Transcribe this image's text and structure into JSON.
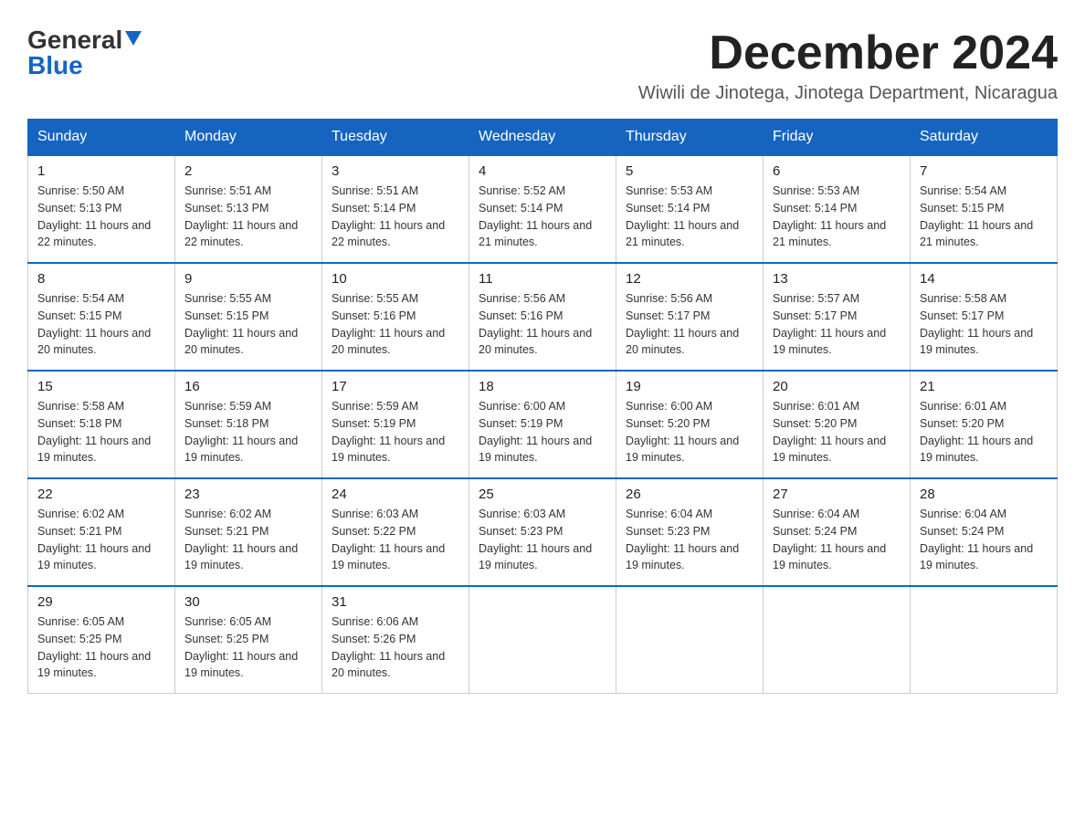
{
  "logo": {
    "general": "General",
    "blue": "Blue"
  },
  "title": "December 2024",
  "subtitle": "Wiwili de Jinotega, Jinotega Department, Nicaragua",
  "days_of_week": [
    "Sunday",
    "Monday",
    "Tuesday",
    "Wednesday",
    "Thursday",
    "Friday",
    "Saturday"
  ],
  "weeks": [
    [
      {
        "day": "1",
        "sunrise": "5:50 AM",
        "sunset": "5:13 PM",
        "daylight": "11 hours and 22 minutes."
      },
      {
        "day": "2",
        "sunrise": "5:51 AM",
        "sunset": "5:13 PM",
        "daylight": "11 hours and 22 minutes."
      },
      {
        "day": "3",
        "sunrise": "5:51 AM",
        "sunset": "5:14 PM",
        "daylight": "11 hours and 22 minutes."
      },
      {
        "day": "4",
        "sunrise": "5:52 AM",
        "sunset": "5:14 PM",
        "daylight": "11 hours and 21 minutes."
      },
      {
        "day": "5",
        "sunrise": "5:53 AM",
        "sunset": "5:14 PM",
        "daylight": "11 hours and 21 minutes."
      },
      {
        "day": "6",
        "sunrise": "5:53 AM",
        "sunset": "5:14 PM",
        "daylight": "11 hours and 21 minutes."
      },
      {
        "day": "7",
        "sunrise": "5:54 AM",
        "sunset": "5:15 PM",
        "daylight": "11 hours and 21 minutes."
      }
    ],
    [
      {
        "day": "8",
        "sunrise": "5:54 AM",
        "sunset": "5:15 PM",
        "daylight": "11 hours and 20 minutes."
      },
      {
        "day": "9",
        "sunrise": "5:55 AM",
        "sunset": "5:15 PM",
        "daylight": "11 hours and 20 minutes."
      },
      {
        "day": "10",
        "sunrise": "5:55 AM",
        "sunset": "5:16 PM",
        "daylight": "11 hours and 20 minutes."
      },
      {
        "day": "11",
        "sunrise": "5:56 AM",
        "sunset": "5:16 PM",
        "daylight": "11 hours and 20 minutes."
      },
      {
        "day": "12",
        "sunrise": "5:56 AM",
        "sunset": "5:17 PM",
        "daylight": "11 hours and 20 minutes."
      },
      {
        "day": "13",
        "sunrise": "5:57 AM",
        "sunset": "5:17 PM",
        "daylight": "11 hours and 19 minutes."
      },
      {
        "day": "14",
        "sunrise": "5:58 AM",
        "sunset": "5:17 PM",
        "daylight": "11 hours and 19 minutes."
      }
    ],
    [
      {
        "day": "15",
        "sunrise": "5:58 AM",
        "sunset": "5:18 PM",
        "daylight": "11 hours and 19 minutes."
      },
      {
        "day": "16",
        "sunrise": "5:59 AM",
        "sunset": "5:18 PM",
        "daylight": "11 hours and 19 minutes."
      },
      {
        "day": "17",
        "sunrise": "5:59 AM",
        "sunset": "5:19 PM",
        "daylight": "11 hours and 19 minutes."
      },
      {
        "day": "18",
        "sunrise": "6:00 AM",
        "sunset": "5:19 PM",
        "daylight": "11 hours and 19 minutes."
      },
      {
        "day": "19",
        "sunrise": "6:00 AM",
        "sunset": "5:20 PM",
        "daylight": "11 hours and 19 minutes."
      },
      {
        "day": "20",
        "sunrise": "6:01 AM",
        "sunset": "5:20 PM",
        "daylight": "11 hours and 19 minutes."
      },
      {
        "day": "21",
        "sunrise": "6:01 AM",
        "sunset": "5:20 PM",
        "daylight": "11 hours and 19 minutes."
      }
    ],
    [
      {
        "day": "22",
        "sunrise": "6:02 AM",
        "sunset": "5:21 PM",
        "daylight": "11 hours and 19 minutes."
      },
      {
        "day": "23",
        "sunrise": "6:02 AM",
        "sunset": "5:21 PM",
        "daylight": "11 hours and 19 minutes."
      },
      {
        "day": "24",
        "sunrise": "6:03 AM",
        "sunset": "5:22 PM",
        "daylight": "11 hours and 19 minutes."
      },
      {
        "day": "25",
        "sunrise": "6:03 AM",
        "sunset": "5:23 PM",
        "daylight": "11 hours and 19 minutes."
      },
      {
        "day": "26",
        "sunrise": "6:04 AM",
        "sunset": "5:23 PM",
        "daylight": "11 hours and 19 minutes."
      },
      {
        "day": "27",
        "sunrise": "6:04 AM",
        "sunset": "5:24 PM",
        "daylight": "11 hours and 19 minutes."
      },
      {
        "day": "28",
        "sunrise": "6:04 AM",
        "sunset": "5:24 PM",
        "daylight": "11 hours and 19 minutes."
      }
    ],
    [
      {
        "day": "29",
        "sunrise": "6:05 AM",
        "sunset": "5:25 PM",
        "daylight": "11 hours and 19 minutes."
      },
      {
        "day": "30",
        "sunrise": "6:05 AM",
        "sunset": "5:25 PM",
        "daylight": "11 hours and 19 minutes."
      },
      {
        "day": "31",
        "sunrise": "6:06 AM",
        "sunset": "5:26 PM",
        "daylight": "11 hours and 20 minutes."
      },
      null,
      null,
      null,
      null
    ]
  ]
}
